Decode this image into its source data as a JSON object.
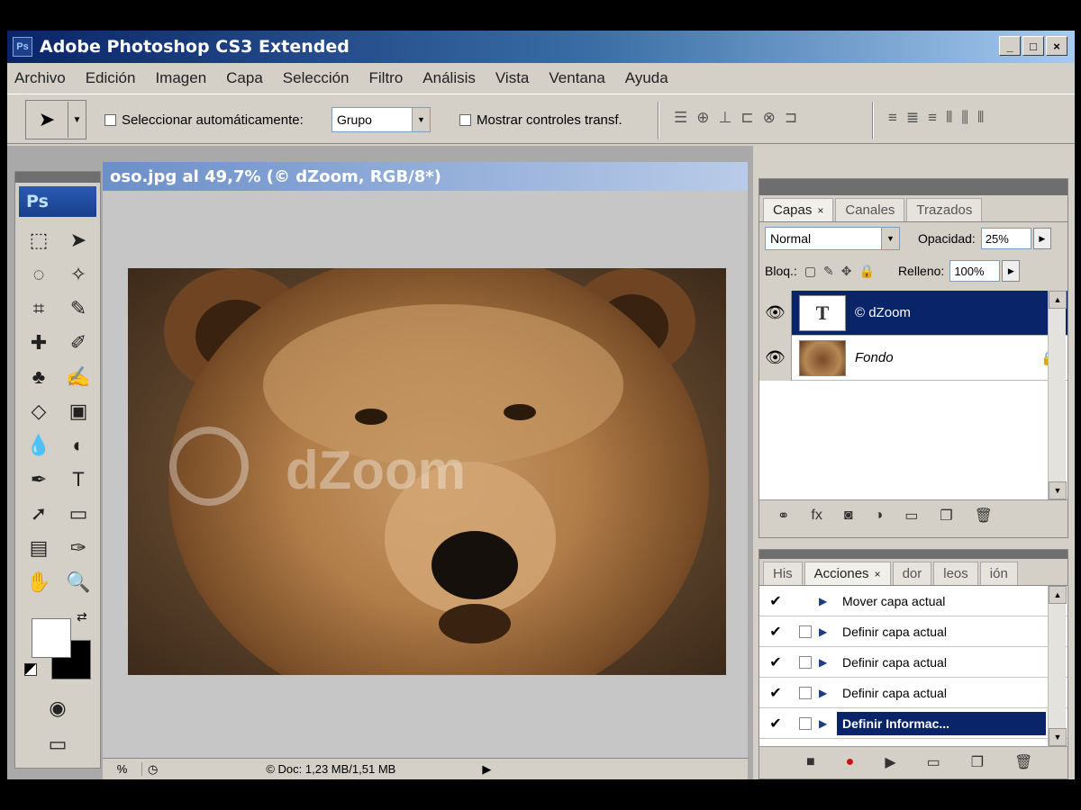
{
  "window": {
    "title": "Adobe Photoshop CS3 Extended",
    "controls": [
      "_",
      "□",
      "×"
    ]
  },
  "menu": [
    "Archivo",
    "Edición",
    "Imagen",
    "Capa",
    "Selección",
    "Filtro",
    "Análisis",
    "Vista",
    "Ventana",
    "Ayuda"
  ],
  "options": {
    "auto_select_label": "Seleccionar automáticamente:",
    "auto_select_value": "Grupo",
    "show_transform_label": "Mostrar controles transf."
  },
  "toolbox": {
    "logo": "Ps",
    "tools": [
      "marquee-tool",
      "move-tool",
      "lasso-tool",
      "magic-wand-tool",
      "crop-tool",
      "slice-tool",
      "healing-brush-tool",
      "brush-tool",
      "clone-stamp-tool",
      "history-brush-tool",
      "eraser-tool",
      "gradient-tool",
      "blur-tool",
      "dodge-tool",
      "pen-tool",
      "type-tool",
      "path-selection-tool",
      "shape-tool",
      "notes-tool",
      "eyedropper-tool",
      "hand-tool",
      "zoom-tool"
    ],
    "foreground_color": "#ffffff",
    "background_color": "#000000"
  },
  "document": {
    "title": "oso.jpg al 49,7% (© dZoom, RGB/8*)",
    "zoom_status": "%",
    "doc_status": "© Doc: 1,23 MB/1,51 MB"
  },
  "layers_panel": {
    "tabs": [
      {
        "label": "Capas",
        "active": true
      },
      {
        "label": "Canales",
        "active": false
      },
      {
        "label": "Trazados",
        "active": false
      }
    ],
    "blend_mode": "Normal",
    "opacity_label": "Opacidad:",
    "opacity_value": "25%",
    "lock_label": "Bloq.:",
    "fill_label": "Relleno:",
    "fill_value": "100%",
    "layers": [
      {
        "thumb": "T",
        "name": "© dZoom",
        "selected": true
      },
      {
        "thumb": "",
        "name": "Fondo",
        "selected": false
      }
    ]
  },
  "actions_panel": {
    "tabs": [
      {
        "label": "His",
        "active": false
      },
      {
        "label": "Acciones",
        "active": true
      },
      {
        "label": "dor",
        "active": false
      },
      {
        "label": "leos",
        "active": false
      },
      {
        "label": "ión",
        "active": false
      }
    ],
    "items": [
      {
        "label": "Mover capa actual",
        "selected": false
      },
      {
        "label": "Definir capa actual",
        "selected": false
      },
      {
        "label": "Definir capa actual",
        "selected": false
      },
      {
        "label": "Definir capa actual",
        "selected": false
      },
      {
        "label": "Definir Informac...",
        "selected": true
      }
    ]
  },
  "colors": {
    "title_gradient_start": "#0a246a",
    "selection": "#0a246a",
    "chrome": "#d4d0c8"
  }
}
